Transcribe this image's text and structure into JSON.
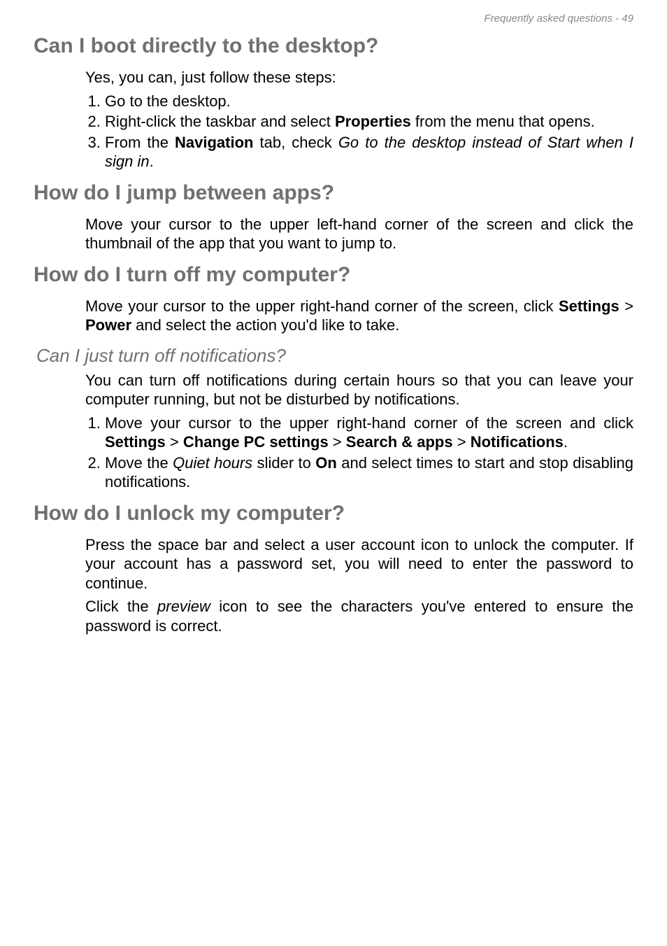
{
  "header": "Frequently asked questions - 49",
  "sections": {
    "boot": {
      "title": "Can I boot directly to the desktop?",
      "intro": "Yes, you can, just follow these steps:",
      "step1": "Go to the desktop.",
      "step2_a": "Right-click the taskbar and select ",
      "step2_b": "Properties",
      "step2_c": " from the menu that opens.",
      "step3_a": "From the ",
      "step3_b": "Navigation",
      "step3_c": " tab, check ",
      "step3_d": "Go to the desktop instead of Start when I sign in",
      "step3_e": "."
    },
    "jump": {
      "title": "How do I jump between apps?",
      "para": "Move your cursor to the upper left-hand corner of the screen and click the thumbnail of the app that you want to jump to."
    },
    "turnoff": {
      "title": "How do I turn off my computer?",
      "para_a": "Move your cursor to the upper right-hand corner of the screen, click ",
      "para_b": "Settings",
      "para_c": " > ",
      "para_d": "Power",
      "para_e": " and select the action you'd like to take.",
      "sub": {
        "title": "Can I just turn off notifications?",
        "para": "You can turn off notifications during certain hours so that you can leave your computer running, but not be disturbed by notifications.",
        "step1_a": "Move your cursor to the upper right-hand corner of the screen and click ",
        "step1_b": "Settings",
        "step1_c": " > ",
        "step1_d": "Change PC settings",
        "step1_e": " > ",
        "step1_f": "Search & apps",
        "step1_g": " > ",
        "step1_h": "Notifications",
        "step1_i": ".",
        "step2_a": "Move the ",
        "step2_b": "Quiet hours",
        "step2_c": " slider to ",
        "step2_d": "On",
        "step2_e": " and select times to start and stop disabling notifications."
      }
    },
    "unlock": {
      "title": "How do I unlock my computer?",
      "para1": "Press the space bar and select a user account icon to unlock the computer. If your account has a password set, you will need to enter the password to continue.",
      "para2_a": "Click the ",
      "para2_b": "preview",
      "para2_c": " icon to see the characters you've entered to ensure the password is correct."
    }
  }
}
